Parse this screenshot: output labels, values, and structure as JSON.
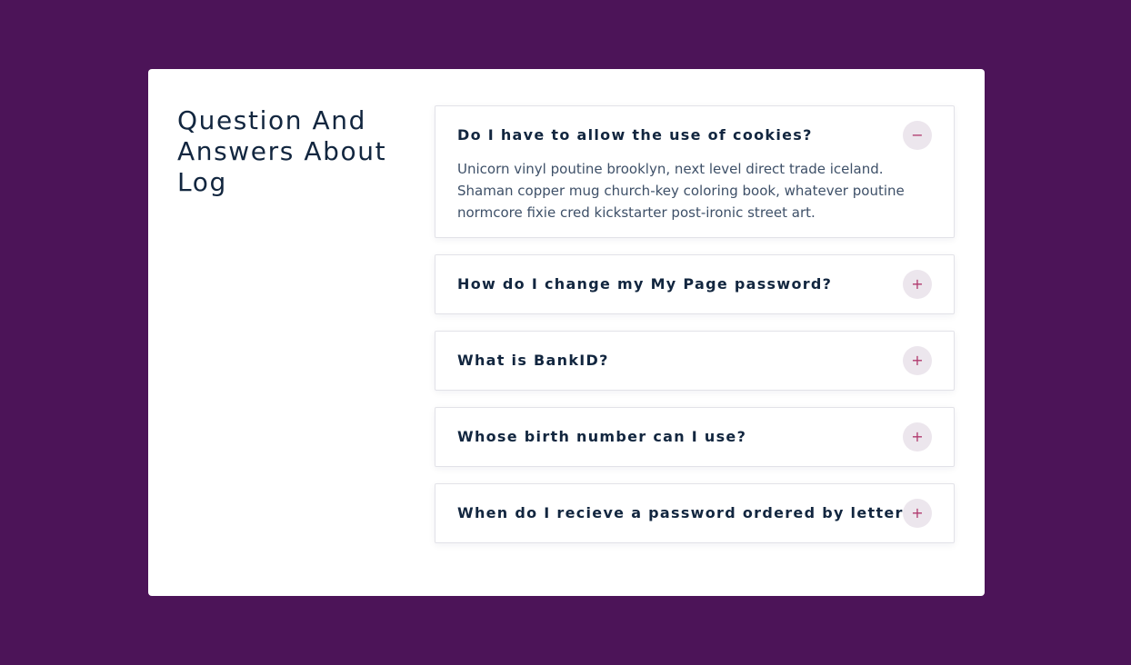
{
  "page": {
    "title": "Question And Answers About Log"
  },
  "colors": {
    "background": "#4c1458",
    "card": "#ffffff",
    "heading": "#12263f",
    "toggle_bg": "#ece6ed",
    "toggle_fg": "#b03a6e"
  },
  "faq": [
    {
      "question": "Do I have to allow the use of cookies?",
      "answer": "Unicorn vinyl poutine brooklyn, next level direct trade iceland. Shaman copper mug church-key coloring book, whatever poutine normcore fixie cred kickstarter post-ironic street art.",
      "expanded": true,
      "toggle_symbol": "−",
      "toggle_icon": "minus-icon"
    },
    {
      "question": "How do I change my My Page password?",
      "expanded": false,
      "toggle_symbol": "+",
      "toggle_icon": "plus-icon"
    },
    {
      "question": "What is BankID?",
      "expanded": false,
      "toggle_symbol": "+",
      "toggle_icon": "plus-icon"
    },
    {
      "question": "Whose birth number can I use?",
      "expanded": false,
      "toggle_symbol": "+",
      "toggle_icon": "plus-icon"
    },
    {
      "question": "When do I recieve a password ordered by letter?",
      "expanded": false,
      "toggle_symbol": "+",
      "toggle_icon": "plus-icon"
    }
  ]
}
